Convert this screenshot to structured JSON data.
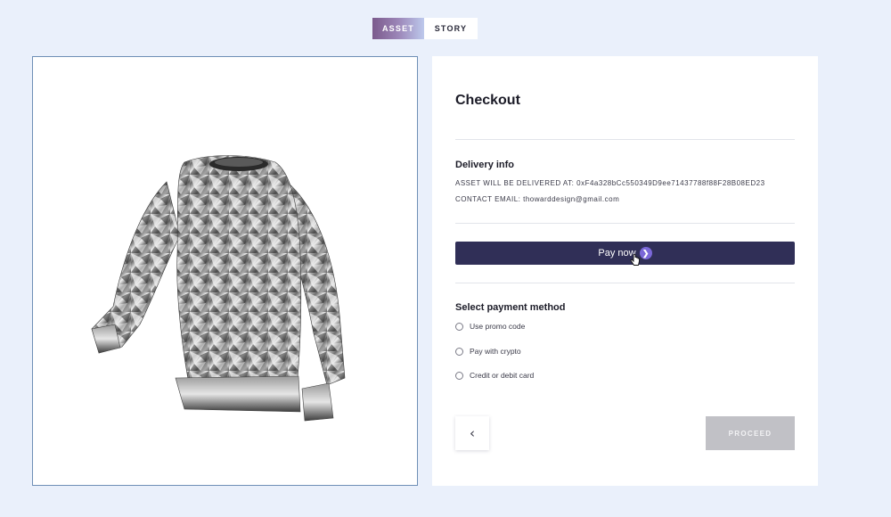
{
  "tabs": [
    {
      "label": "ASSET",
      "active": true
    },
    {
      "label": "STORY",
      "active": false
    }
  ],
  "asset": {
    "image_subject": "metallic chrome sweater"
  },
  "checkout": {
    "title": "Checkout",
    "delivery": {
      "heading": "Delivery info",
      "address_label": "ASSET WILL BE DELIVERED AT:",
      "address_value": "0xF4a328bCc550349D9ee71437788f88F28B08ED23",
      "email_label": "CONTACT EMAIL:",
      "email_value": "thowarddesign@gmail.com"
    },
    "pay_button": {
      "label": "Pay now",
      "icon": "chevron-right-icon"
    },
    "payment": {
      "heading": "Select payment method",
      "options": [
        "Use promo code",
        "Pay with crypto",
        "Credit or debit card"
      ]
    },
    "back_button": {
      "icon": "chevron-left-icon"
    },
    "proceed_button": {
      "label": "PROCEED"
    }
  },
  "colors": {
    "background": "#eaf0fb",
    "pay_button": "#302f57",
    "pay_icon": "#7b68d8",
    "proceed_disabled": "#c1c1c6",
    "tab_gradient_start": "#7b5a8c",
    "tab_gradient_end": "#bdc9ec"
  }
}
